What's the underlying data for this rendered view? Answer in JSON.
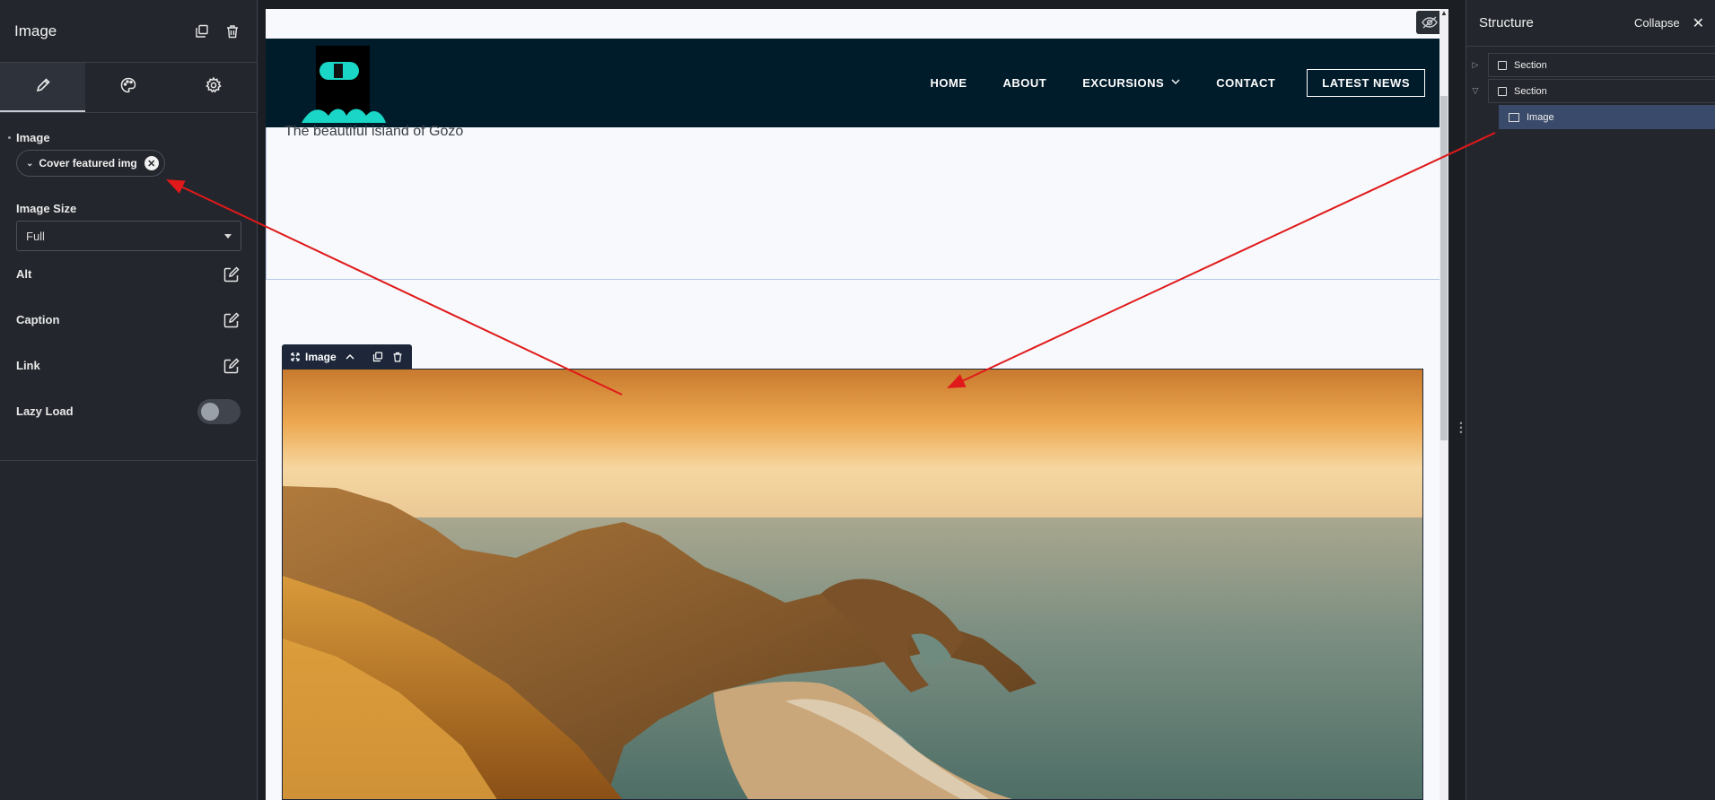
{
  "left_panel": {
    "title": "Image",
    "tabs": [
      {
        "icon": "pencil-icon",
        "active": true
      },
      {
        "icon": "palette-icon",
        "active": false
      },
      {
        "icon": "gear-icon",
        "active": false
      }
    ],
    "image": {
      "label": "Image",
      "chip_text": "Cover featured img"
    },
    "image_size": {
      "label": "Image Size",
      "value": "Full"
    },
    "alt_label": "Alt",
    "caption_label": "Caption",
    "link_label": "Link",
    "lazy_load": {
      "label": "Lazy Load",
      "enabled": false
    }
  },
  "site": {
    "nav": {
      "home": "HOME",
      "about": "ABOUT",
      "excursions": "EXCURSIONS",
      "contact": "CONTACT",
      "latest_news": "LATEST NEWS"
    },
    "subtitle": "The beautiful island of Gozo",
    "colors": {
      "header_bg": "#001b2a",
      "logo_accent": "#1ad6c6"
    }
  },
  "image_toolbar": {
    "label": "Image"
  },
  "structure_panel": {
    "title": "Structure",
    "collapse_label": "Collapse",
    "items": [
      {
        "label": "Section"
      },
      {
        "label": "Section"
      },
      {
        "label": "Image"
      }
    ]
  },
  "annotations": {
    "arrow_color": "#e0191a"
  }
}
